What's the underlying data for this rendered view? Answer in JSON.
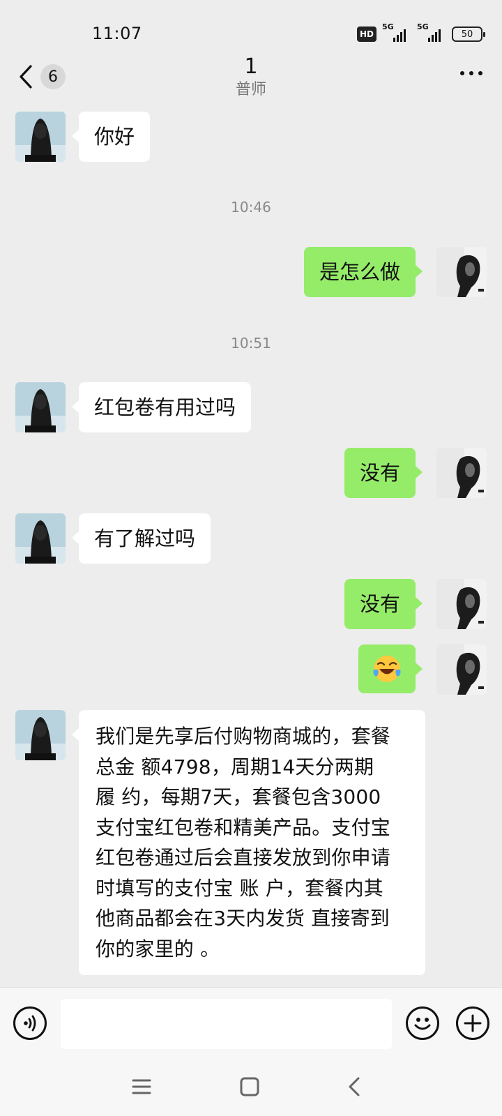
{
  "status_bar": {
    "time": "11:07",
    "hd_label": "HD",
    "signal1_label": "5G",
    "signal2_label": "5G",
    "battery": "50"
  },
  "header": {
    "unread_count": "6",
    "title": "1",
    "subtitle": "普师",
    "back_icon": "chevron-left-icon",
    "more_icon": "more-dots-icon"
  },
  "messages": [
    {
      "side": "in",
      "text": "你好"
    },
    {
      "timestamp": "10:46"
    },
    {
      "side": "out",
      "text": "是怎么做"
    },
    {
      "timestamp": "10:51"
    },
    {
      "side": "in",
      "text": "红包卷有用过吗"
    },
    {
      "side": "out",
      "text": "没有"
    },
    {
      "side": "in",
      "text": "有了解过吗"
    },
    {
      "side": "out",
      "text": "没有"
    },
    {
      "side": "out",
      "text": "🤣"
    },
    {
      "side": "in",
      "lines": [
        "我们是先享后付购物商城的，套餐",
        "总金 额4798，周期14天分两期",
        "履 约，每期7天，套餐包含3000",
        "支付宝红包卷和精美产品。支付宝",
        "红包卷通过后会直接发放到你申请",
        "时填写的支付宝 账 户，套餐内其",
        "他商品都会在3天内发货 直接寄到",
        "你的家里的 。"
      ]
    }
  ],
  "input_bar": {
    "placeholder": "",
    "voice_icon": "voice-icon",
    "emoji_icon": "emoji-icon",
    "plus_icon": "plus-icon"
  },
  "nav_bar": {
    "menu_icon": "menu-icon",
    "home_icon": "home-icon",
    "back_icon": "back-icon"
  },
  "colors": {
    "background": "#ededed",
    "outgoing_bubble": "#95ec69",
    "incoming_bubble": "#ffffff"
  }
}
